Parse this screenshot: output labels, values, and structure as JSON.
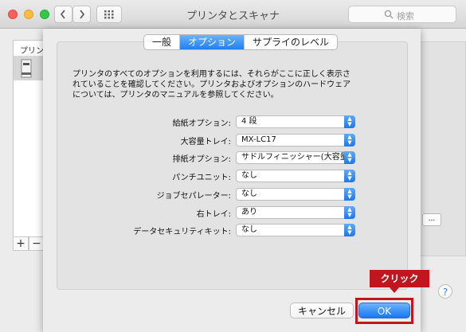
{
  "window": {
    "title": "プリンタとスキャナ",
    "search_placeholder": "検索"
  },
  "sidebar": {
    "heading_partial": "プリン",
    "add_label": "+",
    "remove_label": "−"
  },
  "background": {
    "button_partial": "..."
  },
  "sheet": {
    "tabs": [
      {
        "label": "一般",
        "active": false
      },
      {
        "label": "オプション",
        "active": true
      },
      {
        "label": "サプライのレベル",
        "active": false
      }
    ],
    "description": "プリンタのすべてのオプションを利用するには、それらがここに正しく表示されていることを確認してください。プリンタおよびオプションのハードウェアについては、プリンタのマニュアルを参照してください。",
    "options": [
      {
        "label": "給紙オプション:",
        "value": "4 段"
      },
      {
        "label": "大容量トレイ:",
        "value": "MX-LC17"
      },
      {
        "label": "排紙オプション:",
        "value": "サドルフィニッシャー(大容量)"
      },
      {
        "label": "パンチユニット:",
        "value": "なし"
      },
      {
        "label": "ジョブセパレーター:",
        "value": "なし"
      },
      {
        "label": "右トレイ:",
        "value": "あり"
      },
      {
        "label": "データセキュリティキット:",
        "value": "なし"
      }
    ],
    "cancel_label": "キャンセル",
    "ok_label": "OK"
  },
  "annotation": {
    "callout": "クリック",
    "color": "#c0161e"
  },
  "help_label": "?"
}
